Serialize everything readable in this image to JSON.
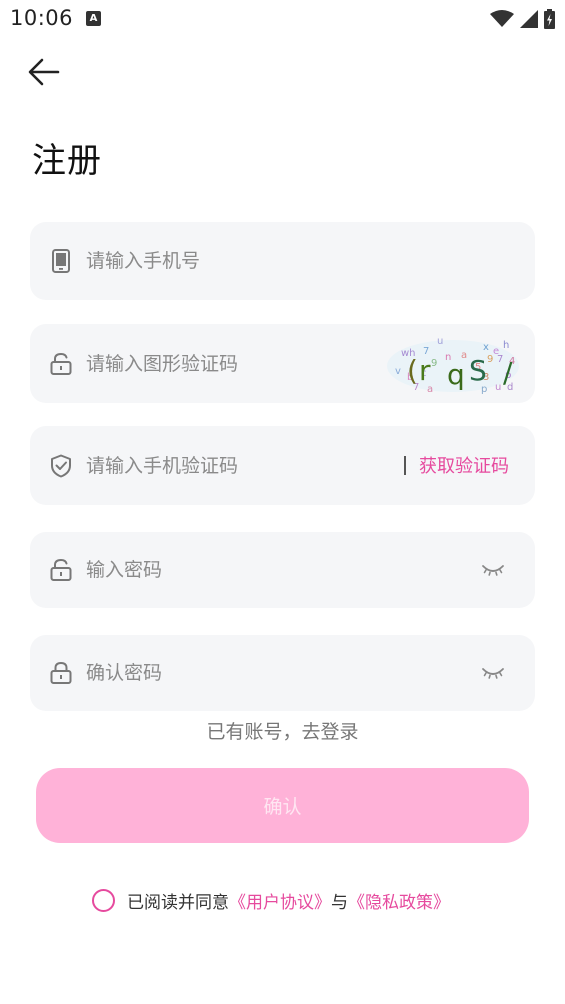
{
  "status_bar": {
    "time": "10:06",
    "notification_badge": "A"
  },
  "header": {
    "back_icon": "arrow-left-icon",
    "title": "注册"
  },
  "form": {
    "phone": {
      "placeholder": "请输入手机号",
      "value": "",
      "icon": "phone-icon"
    },
    "image_code": {
      "placeholder": "请输入图形验证码",
      "value": "",
      "icon": "unlock-icon"
    },
    "sms_code": {
      "placeholder": "请输入手机验证码",
      "value": "",
      "icon": "shield-check-icon",
      "get_code_label": "获取验证码"
    },
    "password": {
      "placeholder": "输入密码",
      "value": "",
      "icon": "unlock-icon"
    },
    "confirm_password": {
      "placeholder": "确认密码",
      "value": "",
      "icon": "lock-icon"
    }
  },
  "login_link": "已有账号，去登录",
  "confirm_button": "确认",
  "agreement": {
    "prefix": "已阅读并同意",
    "user_agreement": "《用户协议》",
    "connector": "与",
    "privacy_policy": "《隐私政策》"
  },
  "colors": {
    "accent": "#e64a9e",
    "button_bg": "#ffb2d8",
    "field_bg": "#f5f6f8"
  }
}
